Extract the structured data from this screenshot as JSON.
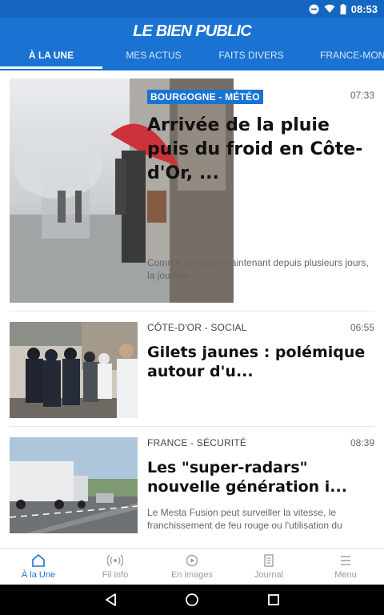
{
  "status_bar": {
    "time": "08:53"
  },
  "header": {
    "logo_text": "LE BIEN PUBLIC"
  },
  "tabs": [
    {
      "label": "À LA UNE",
      "active": true
    },
    {
      "label": "MES ACTUS",
      "active": false
    },
    {
      "label": "FAITS DIVERS",
      "active": false
    },
    {
      "label": "FRANCE-MON",
      "active": false
    }
  ],
  "articles": [
    {
      "rubric": "BOURGOGNE - MÉTÉO",
      "time": "07:33",
      "title": "Arrivée de la pluie puis du froid en Côte-d'Or, ...",
      "summary": "Comme annoncé maintenant depuis plusieurs jours, la journée ..."
    },
    {
      "rubric": "CÔTE-D'OR - SOCIAL",
      "time": "06:55",
      "title": "Gilets jaunes : polémique autour d'u...",
      "summary": ""
    },
    {
      "rubric": "FRANCE - SÉCURITÉ",
      "time": "08:39",
      "title": "Les \"super-radars\" nouvelle génération i...",
      "summary": "Le Mesta Fusion peut surveiller la vitesse, le franchissement de feu rouge ou l'utilisation du téléph..."
    }
  ],
  "bottom_nav": [
    {
      "label": "À la Une",
      "icon": "home-icon",
      "active": true
    },
    {
      "label": "Fil info",
      "icon": "broadcast-icon",
      "active": false
    },
    {
      "label": "En images",
      "icon": "play-icon",
      "active": false
    },
    {
      "label": "Journal",
      "icon": "newspaper-icon",
      "active": false
    },
    {
      "label": "Menu",
      "icon": "menu-icon",
      "active": false
    }
  ],
  "colors": {
    "brand_blue": "#1a73d2",
    "status_blue": "#1566c1"
  }
}
